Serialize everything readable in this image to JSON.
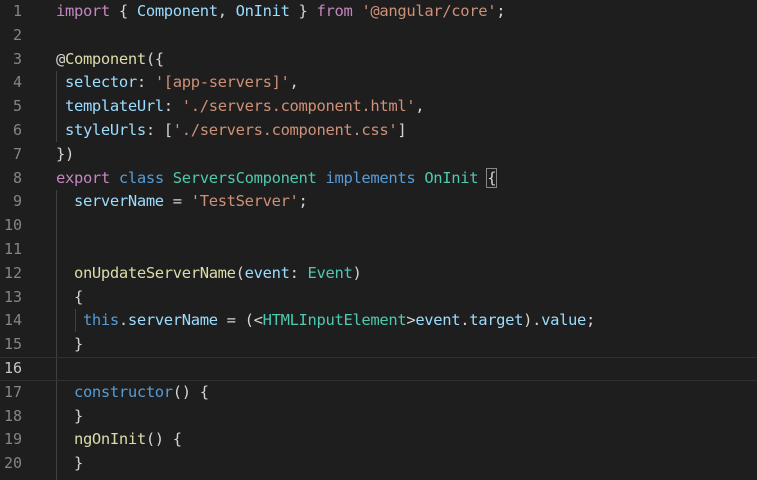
{
  "editor": {
    "lines": [
      {
        "n": "1",
        "tokens": [
          [
            "kw",
            "import"
          ],
          [
            "pun",
            " { "
          ],
          [
            "var",
            "Component"
          ],
          [
            "pun",
            ", "
          ],
          [
            "var",
            "OnInit"
          ],
          [
            "pun",
            " } "
          ],
          [
            "kw",
            "from"
          ],
          [
            "pun",
            " "
          ],
          [
            "str",
            "'@angular/core'"
          ],
          [
            "pun",
            ";"
          ]
        ]
      },
      {
        "n": "2",
        "tokens": []
      },
      {
        "n": "3",
        "tokens": [
          [
            "pun",
            "@"
          ],
          [
            "fn",
            "Component"
          ],
          [
            "pun",
            "({"
          ]
        ]
      },
      {
        "n": "4",
        "tokens": [
          [
            "pun",
            " "
          ],
          [
            "var",
            "selector"
          ],
          [
            "pun",
            ": "
          ],
          [
            "str",
            "'[app-servers]'"
          ],
          [
            "pun",
            ","
          ]
        ]
      },
      {
        "n": "5",
        "tokens": [
          [
            "pun",
            " "
          ],
          [
            "var",
            "templateUrl"
          ],
          [
            "pun",
            ": "
          ],
          [
            "str",
            "'./servers.component.html'"
          ],
          [
            "pun",
            ","
          ]
        ]
      },
      {
        "n": "6",
        "tokens": [
          [
            "pun",
            " "
          ],
          [
            "var",
            "styleUrls"
          ],
          [
            "pun",
            ": ["
          ],
          [
            "str",
            "'./servers.component.css'"
          ],
          [
            "pun",
            "]"
          ]
        ]
      },
      {
        "n": "7",
        "tokens": [
          [
            "pun",
            "})"
          ]
        ]
      },
      {
        "n": "8",
        "tokens": [
          [
            "kw",
            "export"
          ],
          [
            "pun",
            " "
          ],
          [
            "sk",
            "class"
          ],
          [
            "pun",
            " "
          ],
          [
            "cls",
            "ServersComponent"
          ],
          [
            "pun",
            " "
          ],
          [
            "sk",
            "implements"
          ],
          [
            "pun",
            " "
          ],
          [
            "cls",
            "OnInit"
          ],
          [
            "pun",
            " "
          ],
          [
            "bm",
            "{"
          ]
        ]
      },
      {
        "n": "9",
        "tokens": [
          [
            "pun",
            "  "
          ],
          [
            "var",
            "serverName"
          ],
          [
            "pun",
            " = "
          ],
          [
            "str",
            "'TestServer'"
          ],
          [
            "pun",
            ";"
          ]
        ]
      },
      {
        "n": "10",
        "tokens": []
      },
      {
        "n": "11",
        "tokens": []
      },
      {
        "n": "12",
        "tokens": [
          [
            "pun",
            "  "
          ],
          [
            "fn",
            "onUpdateServerName"
          ],
          [
            "pun",
            "("
          ],
          [
            "var",
            "event"
          ],
          [
            "pun",
            ": "
          ],
          [
            "cls",
            "Event"
          ],
          [
            "pun",
            ")"
          ]
        ]
      },
      {
        "n": "13",
        "tokens": [
          [
            "pun",
            "  {"
          ]
        ]
      },
      {
        "n": "14",
        "tokens": [
          [
            "pun",
            "   "
          ],
          [
            "sk",
            "this"
          ],
          [
            "pun",
            "."
          ],
          [
            "var",
            "serverName"
          ],
          [
            "pun",
            " = (<"
          ],
          [
            "cls",
            "HTMLInputElement"
          ],
          [
            "pun",
            ">"
          ],
          [
            "var",
            "event"
          ],
          [
            "pun",
            "."
          ],
          [
            "var",
            "target"
          ],
          [
            "pun",
            ")."
          ],
          [
            "var",
            "value"
          ],
          [
            "pun",
            ";"
          ]
        ]
      },
      {
        "n": "15",
        "tokens": [
          [
            "pun",
            "  }"
          ]
        ]
      },
      {
        "n": "16",
        "tokens": [],
        "active": true
      },
      {
        "n": "17",
        "tokens": [
          [
            "pun",
            "  "
          ],
          [
            "sk",
            "constructor"
          ],
          [
            "pun",
            "() {"
          ]
        ]
      },
      {
        "n": "18",
        "tokens": [
          [
            "pun",
            "  }"
          ]
        ]
      },
      {
        "n": "19",
        "tokens": [
          [
            "pun",
            "  "
          ],
          [
            "fn",
            "ngOnInit"
          ],
          [
            "pun",
            "() {"
          ]
        ]
      },
      {
        "n": "20",
        "tokens": [
          [
            "pun",
            "  }"
          ]
        ]
      }
    ]
  },
  "colors": {
    "background": "#1e1e1e",
    "keyword": "#c586c0",
    "storage": "#569cd6",
    "type": "#4ec9b0",
    "variable": "#9cdcfe",
    "function": "#dcdcaa",
    "string": "#ce9178",
    "line_number": "#858585"
  }
}
